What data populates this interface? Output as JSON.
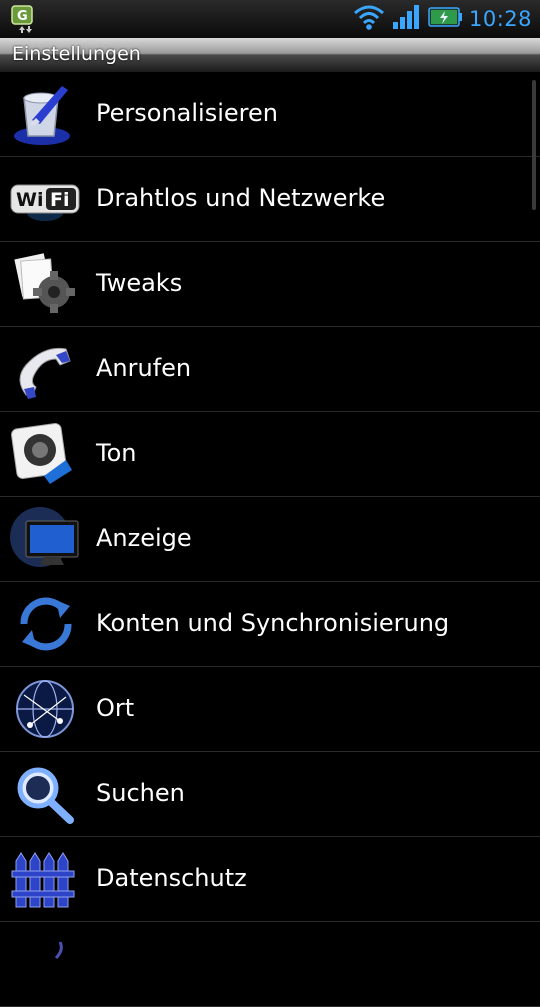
{
  "status": {
    "time": "10:28"
  },
  "header": {
    "title": "Einstellungen"
  },
  "items": [
    {
      "label": "Personalisieren",
      "icon": "paint-bucket-icon"
    },
    {
      "label": "Drahtlos und Netzwerke",
      "icon": "wifi-icon"
    },
    {
      "label": "Tweaks",
      "icon": "gear-icon"
    },
    {
      "label": "Anrufen",
      "icon": "phone-icon"
    },
    {
      "label": "Ton",
      "icon": "speaker-icon"
    },
    {
      "label": "Anzeige",
      "icon": "monitor-icon"
    },
    {
      "label": "Konten und Synchronisierung",
      "icon": "sync-icon"
    },
    {
      "label": "Ort",
      "icon": "globe-icon"
    },
    {
      "label": "Suchen",
      "icon": "magnifier-icon"
    },
    {
      "label": "Datenschutz",
      "icon": "fence-icon"
    }
  ]
}
